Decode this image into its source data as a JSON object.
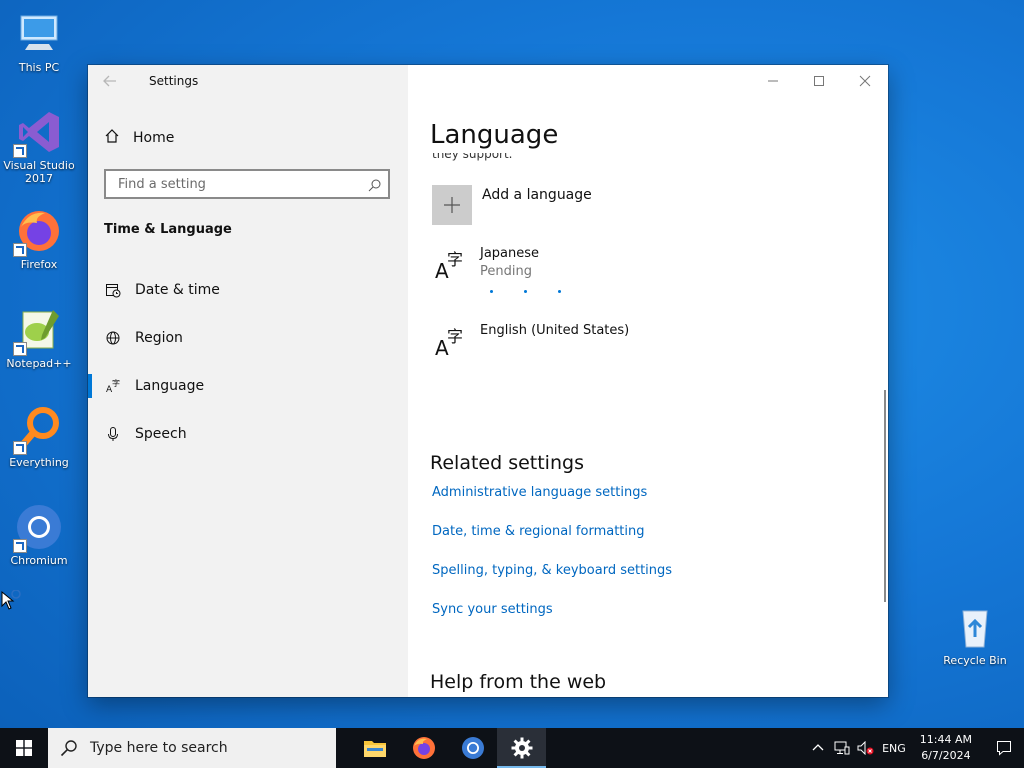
{
  "desktop": {
    "icons": [
      {
        "label": "This PC"
      },
      {
        "label": "Visual Studio 2017"
      },
      {
        "label": "Firefox"
      },
      {
        "label": "Notepad++"
      },
      {
        "label": "Everything"
      },
      {
        "label": "Chromium"
      },
      {
        "label": "Recycle Bin"
      }
    ]
  },
  "window": {
    "title": "Settings",
    "sidebar": {
      "home_label": "Home",
      "search_placeholder": "Find a setting",
      "section_title": "Time & Language",
      "items": [
        {
          "label": "Date & time",
          "icon": "calendar-clock-icon"
        },
        {
          "label": "Region",
          "icon": "globe-icon"
        },
        {
          "label": "Language",
          "icon": "language-icon",
          "selected": true
        },
        {
          "label": "Speech",
          "icon": "microphone-icon"
        }
      ]
    },
    "content": {
      "page_title": "Language",
      "clipped_text": "they support.",
      "add_language_label": "Add a language",
      "languages": [
        {
          "name": "Japanese",
          "status": "Pending"
        },
        {
          "name": "English (United States)"
        }
      ],
      "related_title": "Related settings",
      "related_links": [
        "Administrative language settings",
        "Date, time & regional formatting",
        "Spelling, typing, & keyboard settings",
        "Sync your settings"
      ],
      "help_title": "Help from the web"
    }
  },
  "taskbar": {
    "search_placeholder": "Type here to search",
    "apps": [
      "file-explorer-icon",
      "firefox-icon",
      "chromium-icon",
      "settings-icon"
    ],
    "input_language": "ENG",
    "time": "11:44 AM",
    "date": "6/7/2024"
  },
  "colors": {
    "accent": "#0078d7",
    "link": "#0067c0",
    "sidebar_bg": "#f2f2f2",
    "taskbar_bg": "#0d1117"
  }
}
